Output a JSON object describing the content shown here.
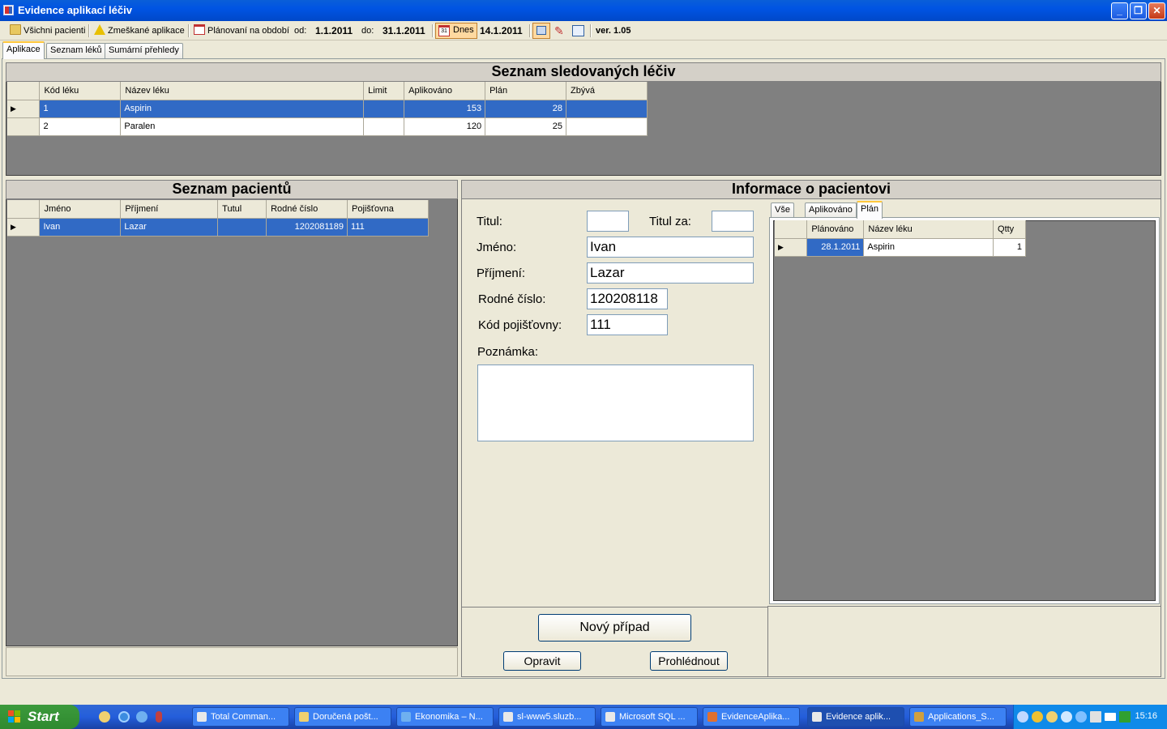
{
  "window": {
    "title": "Evidence aplikací léčiv"
  },
  "toolbar": {
    "all_patients": "Všichni pacienti",
    "missed": "Zmeškané aplikace",
    "planning": "Plánovaní na období",
    "from_label": "od:",
    "from_value": "1.1.2011",
    "to_label": "do:",
    "to_value": "31.1.2011",
    "today_label": "Dnes",
    "today_day": "31",
    "today_value": "14.1.2011",
    "version": "ver. 1.05"
  },
  "tabs": [
    "Aplikace",
    "Seznam léků",
    "Sumární přehledy"
  ],
  "drugs": {
    "heading": "Seznam sledovaných léčiv",
    "columns": [
      "Kód léku",
      "Název léku",
      "Limit",
      "Aplikováno",
      "Plán",
      "Zbývá"
    ],
    "rows": [
      {
        "code": "1",
        "name": "Aspirin",
        "limit": "",
        "applied": "153",
        "plan": "28",
        "left": ""
      },
      {
        "code": "2",
        "name": "Paralen",
        "limit": "",
        "applied": "120",
        "plan": "25",
        "left": ""
      }
    ]
  },
  "patients": {
    "heading": "Seznam pacientů",
    "columns": [
      "Jméno",
      "Příjmení",
      "Tutul",
      "Rodné číslo",
      "Pojišťovna"
    ],
    "rows": [
      {
        "first": "Ivan",
        "last": "Lazar",
        "title": "",
        "birth": "1202081189",
        "insurer": "111"
      }
    ]
  },
  "info": {
    "heading": "Informace o pacientovi",
    "labels": {
      "title": "Titul:",
      "title_after": "Titul za:",
      "first": "Jméno:",
      "last": "Příjmení:",
      "birth": "Rodné číslo:",
      "insurer": "Kód pojišťovny:",
      "note": "Poznámka:"
    },
    "values": {
      "title": "",
      "title_after": "",
      "first": "Ivan",
      "last": "Lazar",
      "birth": "120208118",
      "insurer": "111",
      "note": ""
    },
    "subtabs": [
      "Vše",
      "Aplikováno",
      "Plán"
    ],
    "plan_columns": [
      "Plánováno",
      "Název léku",
      "Qtty"
    ],
    "plan_rows": [
      {
        "date": "28.1.2011",
        "name": "Aspirin",
        "qty": "1"
      }
    ],
    "buttons": {
      "new_case": "Nový případ",
      "edit": "Opravit",
      "view": "Prohlédnout"
    }
  },
  "taskbar": {
    "start": "Start",
    "tasks": [
      "Total Comman...",
      "Doručená pošt...",
      "Ekonomika – N...",
      "sl-www5.sluzb...",
      "Microsoft SQL ...",
      "EvidenceAplika...",
      "Evidence aplik...",
      "Applications_S..."
    ],
    "clock": "15:16"
  },
  "colors": {
    "selection": "#316ac5",
    "titlebar": "#0054e3",
    "panel": "#808080"
  }
}
